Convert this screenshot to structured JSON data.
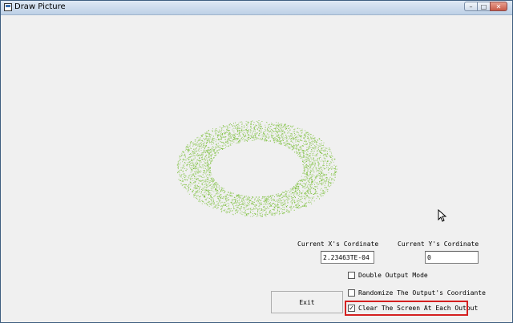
{
  "window": {
    "title": "Draw Picture",
    "minimize_glyph": "–",
    "maximize_glyph": "□",
    "close_glyph": "✕"
  },
  "drawing": {
    "shape": "ring",
    "color": "#7bbf3a"
  },
  "coords": {
    "x_label": "Current X's Cordinate",
    "x_value": "2.23463TE-04",
    "y_label": "Current Y's Cordinate",
    "y_value": "0"
  },
  "options": {
    "double_output": {
      "label": "Double Output Mode",
      "checked": false
    },
    "randomize": {
      "label": "Randomize The Output's Coordiante",
      "checked": false
    },
    "clear_screen": {
      "label": "Clear The Screen At Each Output",
      "checked": true
    }
  },
  "buttons": {
    "exit": "Exit"
  },
  "colors": {
    "highlight": "#d42020"
  }
}
